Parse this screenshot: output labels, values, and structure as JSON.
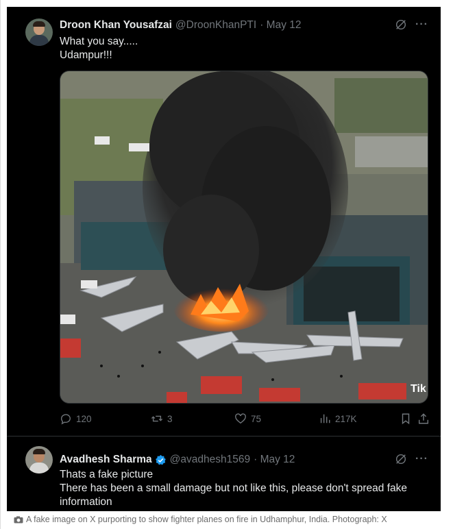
{
  "tweet1": {
    "name": "Droon Khan Yousafzai",
    "handle": "@DroonKhanPTI",
    "date": "· May 12",
    "lines": [
      "What you say.....",
      "Udampur!!!"
    ],
    "media_watermark": "Tik",
    "metrics": {
      "replies": "120",
      "reposts": "3",
      "likes": "75",
      "views": "217K"
    }
  },
  "tweet2": {
    "name": "Avadhesh Sharma",
    "handle": "@avadhesh1569",
    "date": "· May 12",
    "lines": [
      "Thats a fake picture",
      "There has been a small damage but not like this, please don't spread fake",
      "information"
    ]
  },
  "caption": "A fake image on X purporting to show fighter planes on fire in Udhamphur, India. Photograph: X",
  "colors": {
    "background": "#000000",
    "text": "#e7e9ea",
    "muted": "#71767b",
    "verified": "#1d9bf0"
  },
  "icons": [
    "grok-icon",
    "more-icon",
    "reply-icon",
    "repost-icon",
    "like-icon",
    "views-icon",
    "bookmark-icon",
    "share-icon",
    "verified-icon",
    "camera-icon"
  ]
}
